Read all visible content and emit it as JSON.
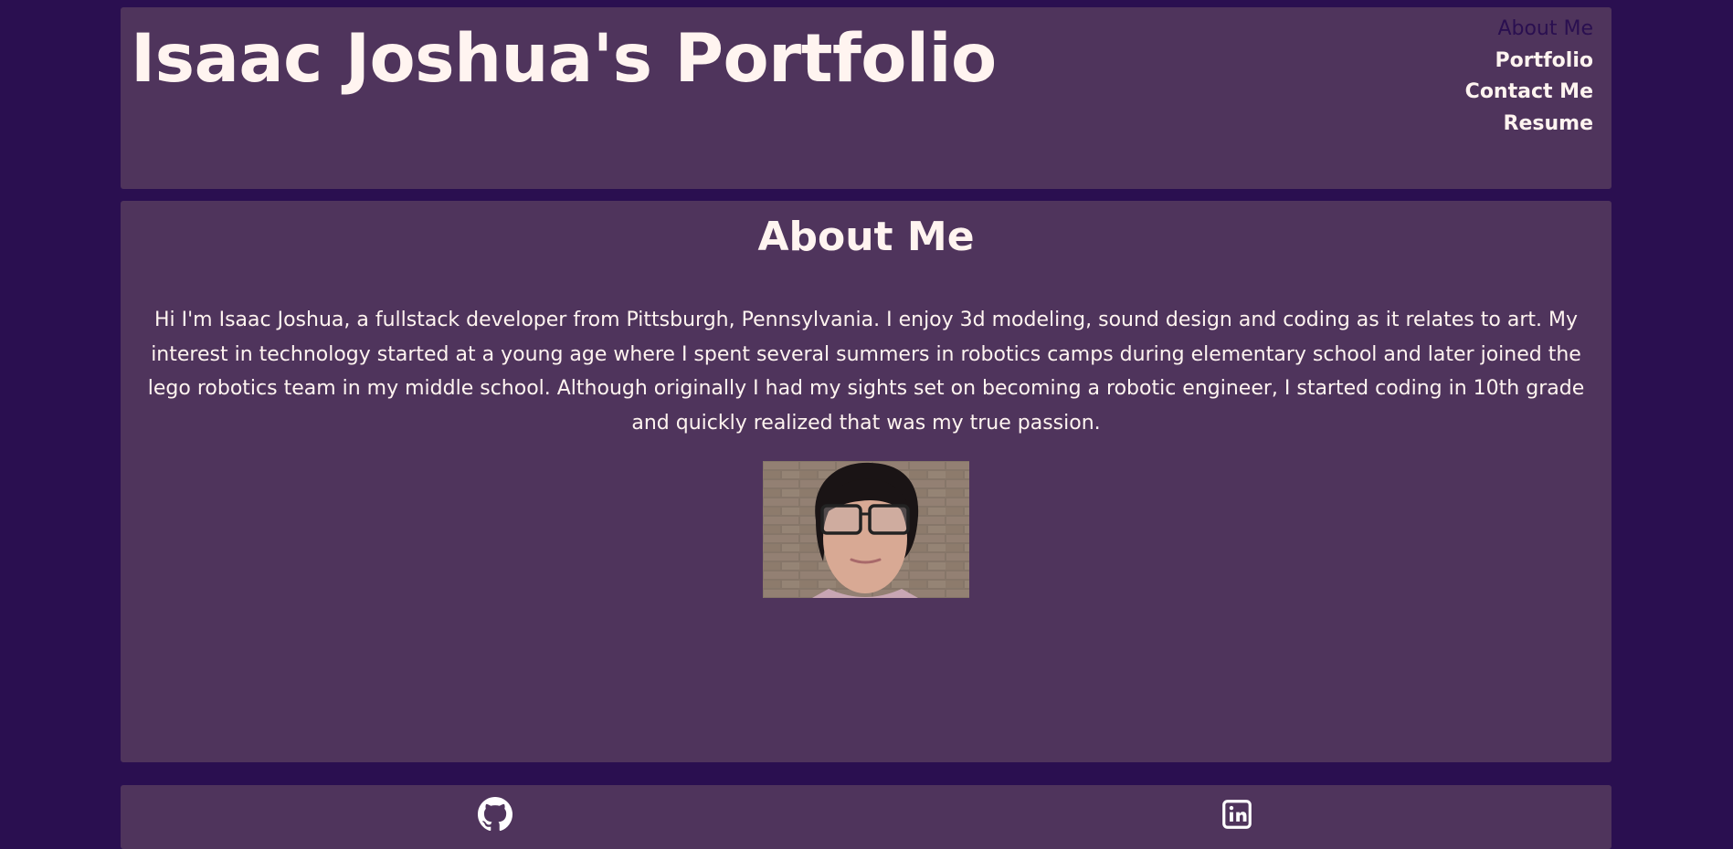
{
  "header": {
    "title": "Isaac Joshua's Portfolio"
  },
  "nav": {
    "items": [
      {
        "label": "About Me",
        "active": true
      },
      {
        "label": "Portfolio",
        "active": false
      },
      {
        "label": "Contact Me",
        "active": false
      },
      {
        "label": "Resume",
        "active": false
      }
    ]
  },
  "main": {
    "title": "About Me",
    "bio": "Hi I'm Isaac Joshua, a fullstack developer from Pittsburgh, Pennsylvania. I enjoy 3d modeling, sound design and coding as it relates to art. My interest in technology started at a young age where I spent several summers in robotics camps during elementary school and later joined the lego robotics team in my middle school. Although originally I had my sights set on becoming a robotic engineer, I started coding in 10th grade and quickly realized that was my true passion."
  },
  "footer": {
    "links": [
      {
        "icon": "github-icon"
      },
      {
        "icon": "linkedin-icon"
      }
    ]
  },
  "colors": {
    "page_background": "#2a0f50",
    "panel_background": "#4f345c",
    "text": "#fff4f0",
    "nav_active": "#2a0f50"
  }
}
